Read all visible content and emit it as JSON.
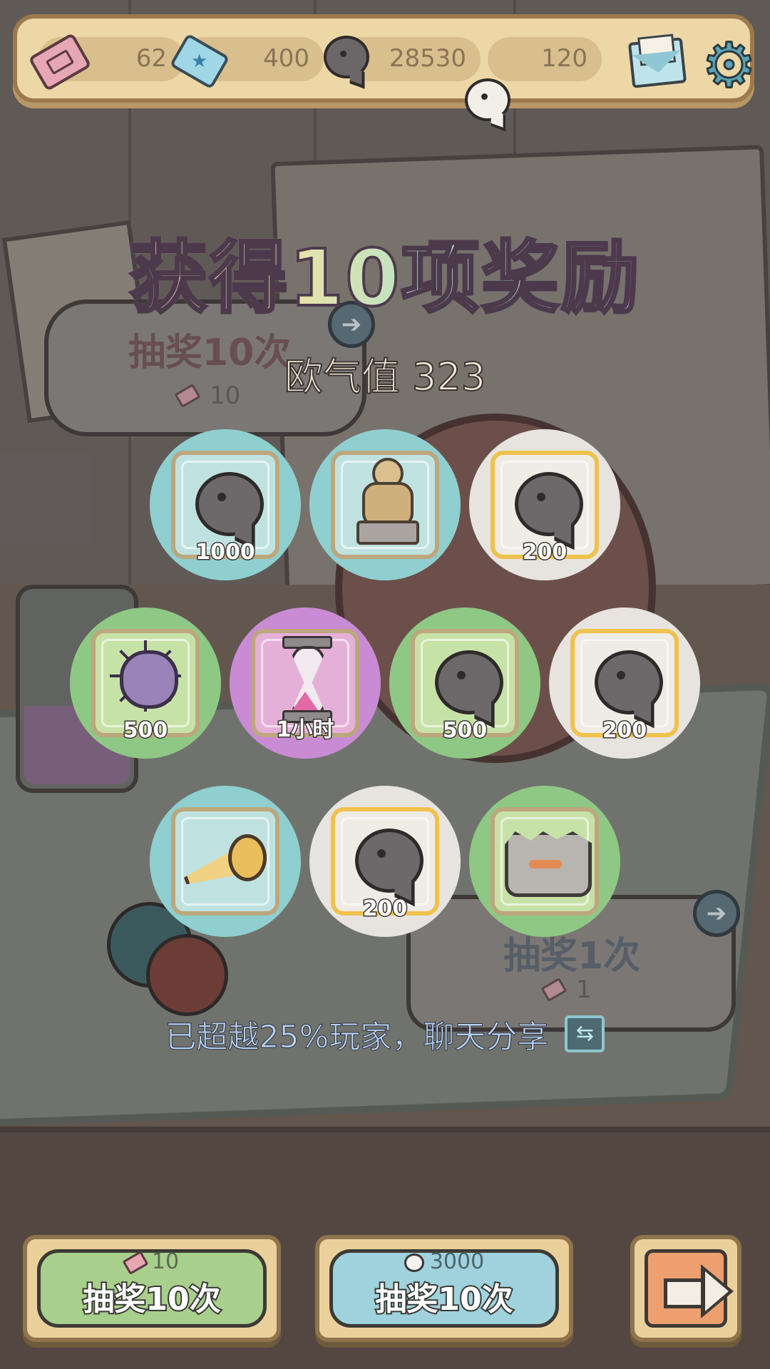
{
  "resources": {
    "tickets": "62",
    "crystals": "400",
    "dark_bubbles": "28530",
    "white_bubbles": "120"
  },
  "header_icons": {
    "mail": "mail-icon",
    "settings": "gear-icon"
  },
  "background_panels": {
    "draw10": {
      "title": "抽奖10次",
      "cost": "10"
    },
    "draw1": {
      "title": "抽奖1次",
      "cost": "1"
    }
  },
  "result": {
    "title": "获得10项奖励",
    "luck_label": "欧气值 323"
  },
  "rewards": [
    {
      "item": "speech-bubble",
      "quantity": "1000",
      "rarity": "teal"
    },
    {
      "item": "statue",
      "quantity": "",
      "rarity": "teal"
    },
    {
      "item": "speech-bubble",
      "quantity": "200",
      "rarity": "white"
    },
    {
      "item": "virus",
      "quantity": "500",
      "rarity": "green"
    },
    {
      "item": "hourglass",
      "quantity": "1小时",
      "rarity": "purple"
    },
    {
      "item": "speech-bubble",
      "quantity": "500",
      "rarity": "green"
    },
    {
      "item": "speech-bubble",
      "quantity": "200",
      "rarity": "white"
    },
    {
      "item": "horn",
      "quantity": "",
      "rarity": "teal"
    },
    {
      "item": "speech-bubble",
      "quantity": "200",
      "rarity": "white"
    },
    {
      "item": "rock-idol",
      "quantity": "",
      "rarity": "green"
    }
  ],
  "share": {
    "text": "已超越25%玩家，聊天分享",
    "icon": "share-icon"
  },
  "buttons": {
    "draw10_ticket": {
      "cost": "10",
      "label": "抽奖10次"
    },
    "draw10_bubble": {
      "cost": "3000",
      "label": "抽奖10次"
    },
    "next": {
      "icon": "arrow-right-icon"
    }
  },
  "colors": {
    "teal": "#8fcfcf",
    "white": "#e7e4e0",
    "green": "#8fc884",
    "purple": "#c88bd4",
    "panel": "#eed7a7"
  }
}
